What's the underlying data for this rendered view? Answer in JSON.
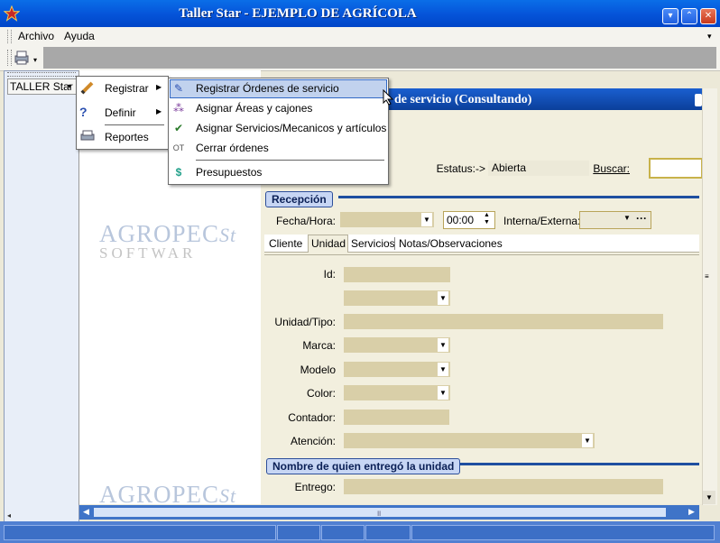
{
  "window": {
    "title": "Taller Star - EJEMPLO DE AGRÍCOLA"
  },
  "menubar": {
    "items": [
      "Archivo",
      "Ayuda"
    ]
  },
  "left_pane": {
    "button_label": "TALLER Star"
  },
  "logo": {
    "text": "AGROPEC",
    "script": "St",
    "sub": "SOFTWAR"
  },
  "main_menu": {
    "items": [
      "Registrar",
      "Definir",
      "Reportes"
    ]
  },
  "submenu": {
    "items": [
      "Registrar Órdenes de servicio",
      "Asignar Áreas y cajones",
      "Asignar Servicios/Mecanicos y artículos",
      "Cerrar órdenes",
      "Presupuestos"
    ]
  },
  "form": {
    "header": "de servicio (Consultando)",
    "status_label": "Estatus:->",
    "status_value": "Abierta",
    "search_label": "Buscar:",
    "search_value": "",
    "section_reception": "Recepción",
    "date_label": "Fecha/Hora:",
    "time_value": "00:00",
    "internal_label": "Interna/Externa:",
    "tabs": [
      "Cliente",
      "Unidad",
      "Servicios",
      "Notas/Observaciones"
    ],
    "fields": {
      "id": "Id:",
      "unit_type": "Unidad/Tipo:",
      "brand": "Marca:",
      "model": "Modelo",
      "color": "Color:",
      "counter": "Contador:",
      "attention": "Atención:"
    },
    "section_delivered": "Nombre de quien entregó la unidad",
    "delivered_label": "Entrego:"
  },
  "colors": {
    "accent": "#0553d8",
    "field": "#d9cfa8",
    "highlight": "#c1d2ee"
  }
}
